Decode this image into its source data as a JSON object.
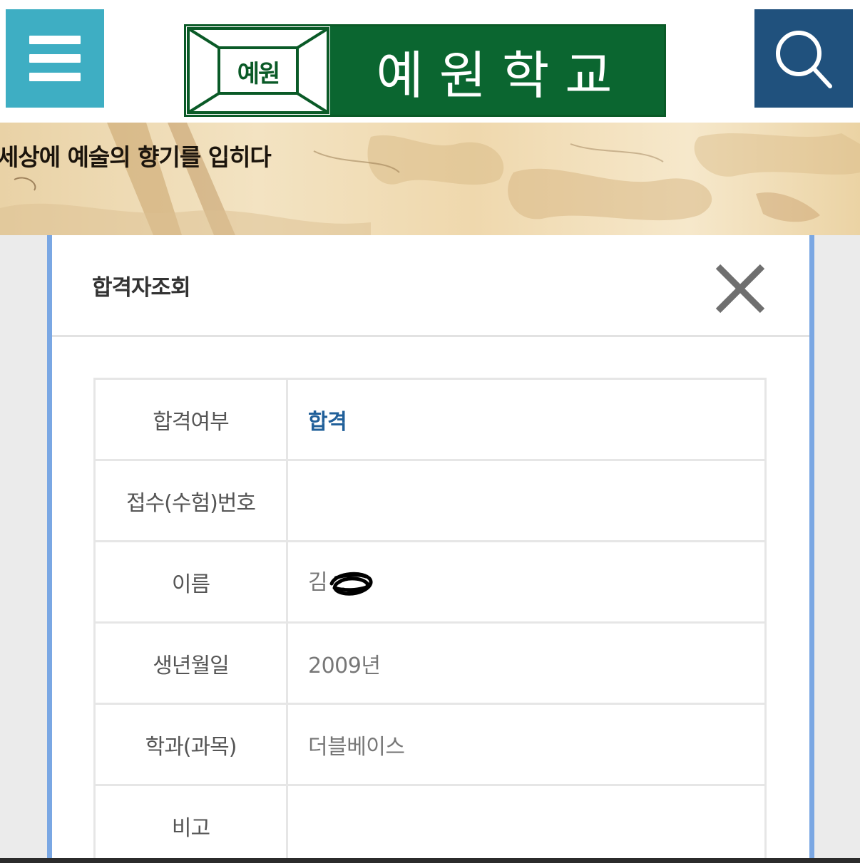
{
  "header": {
    "menu_icon": "hamburger-icon",
    "search_icon": "magnifier-icon",
    "logo": {
      "seal_text": "예원",
      "school_name": "예원학교",
      "green": "#0b6630"
    },
    "colors": {
      "menu": "#3eaec3",
      "search": "#20517d"
    }
  },
  "banner": {
    "slogan": "세상에 예술의 향기를 입히다"
  },
  "modal": {
    "title": "합격자조회",
    "close_icon": "close-icon",
    "rows": [
      {
        "label": "합격여부",
        "value": "합격"
      },
      {
        "label": "접수(수험)번호",
        "value": ""
      },
      {
        "label": "이름",
        "value": "김"
      },
      {
        "label": "생년월일",
        "value": "2009년"
      },
      {
        "label": "학과(과목)",
        "value": "더블베이스"
      },
      {
        "label": "비고",
        "value": ""
      }
    ],
    "accent": "#21609a"
  }
}
